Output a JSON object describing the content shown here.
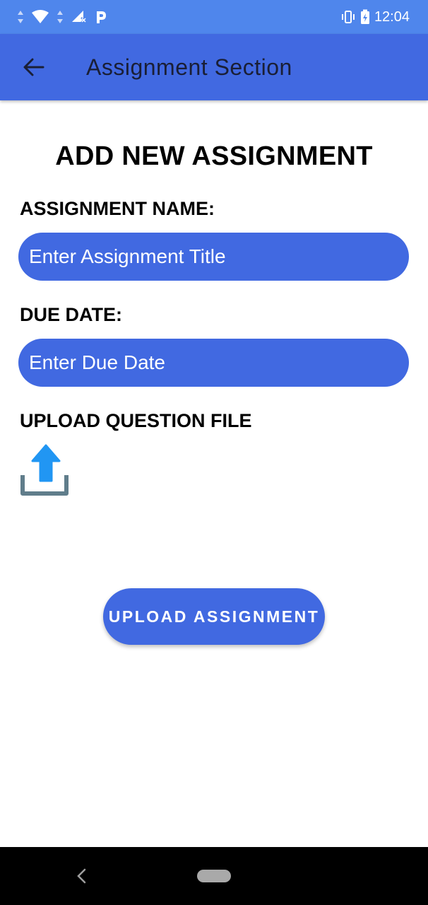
{
  "status_bar": {
    "time": "12:04",
    "icons": [
      "data-transfer-icon",
      "wifi-icon",
      "signal-off-icon",
      "parking-icon",
      "vibrate-icon",
      "battery-charging-icon"
    ]
  },
  "app_bar": {
    "title": "Assignment Section",
    "back_icon": "arrow-left-icon"
  },
  "form": {
    "heading": "ADD NEW ASSIGNMENT",
    "name_label": "ASSIGNMENT NAME:",
    "name_placeholder": "Enter Assignment Title",
    "name_value": "",
    "due_label": "DUE DATE:",
    "due_placeholder": "Enter Due Date",
    "due_value": "",
    "file_label": "UPLOAD QUESTION FILE",
    "file_icon": "upload-icon",
    "submit_label": "UPLOAD ASSIGNMENT"
  },
  "nav_bar": {
    "icons": [
      "nav-back-icon",
      "home-pill-icon"
    ]
  },
  "colors": {
    "status_bar": "#4f86ec",
    "primary": "#4169e1",
    "upload_arrow": "#2196f3",
    "upload_tray": "#607d8b"
  }
}
